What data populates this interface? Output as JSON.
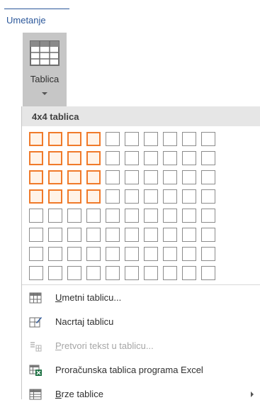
{
  "ribbon": {
    "tab_label": "Umetanje",
    "table_button_label": "Tablica"
  },
  "table_grid": {
    "header_label": "4x4 tablica",
    "columns": 10,
    "rows": 8,
    "selected_columns": 4,
    "selected_rows": 4,
    "selection_color": "#f07a2a"
  },
  "menu": {
    "items": [
      {
        "id": "insert-table",
        "access_key": "U",
        "rest": "metni tablicu...",
        "enabled": true,
        "icon": "table-icon"
      },
      {
        "id": "draw-table",
        "access_key": "",
        "rest": "Nacrtaj tablicu",
        "enabled": true,
        "icon": "draw-table-icon"
      },
      {
        "id": "convert-text",
        "access_key": "P",
        "rest": "retvori tekst u tablicu...",
        "enabled": false,
        "icon": "convert-text-icon"
      },
      {
        "id": "excel-table",
        "access_key": "",
        "rest": "Proračunska tablica programa Excel",
        "enabled": true,
        "icon": "excel-icon"
      },
      {
        "id": "quick-tables",
        "access_key": "B",
        "rest": "rze tablice",
        "enabled": true,
        "icon": "quick-tables-icon",
        "submenu": true
      }
    ]
  },
  "colors": {
    "accent": "#2b579a",
    "button_active_bg": "#c6c6c6",
    "header_bg": "#e6e6e6"
  }
}
